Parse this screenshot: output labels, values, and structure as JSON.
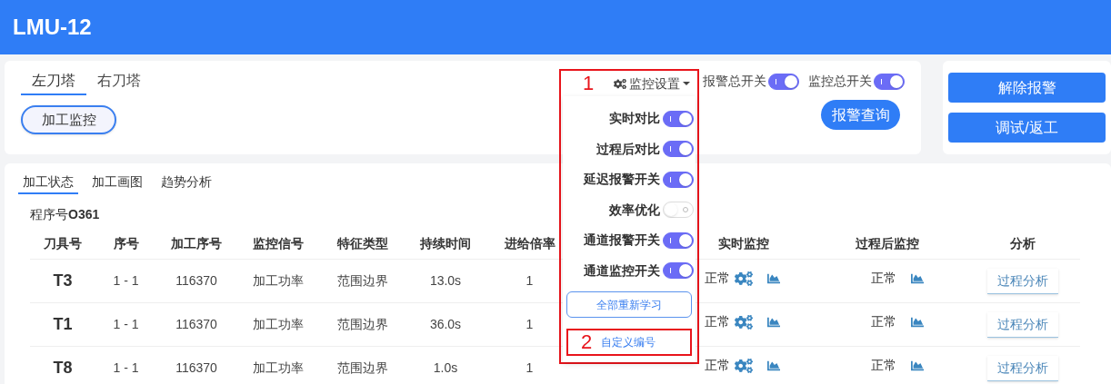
{
  "header": {
    "title": "LMU-12"
  },
  "turret_tabs": [
    {
      "label": "左刀塔",
      "selected": true
    },
    {
      "label": "右刀塔",
      "selected": false
    }
  ],
  "mode_button": "加工监控",
  "monitor_settings": {
    "label": "监控设置",
    "expanded": true,
    "items": [
      {
        "label": "实时对比",
        "on": true
      },
      {
        "label": "过程后对比",
        "on": true
      },
      {
        "label": "延迟报警开关",
        "on": true
      },
      {
        "label": "效率优化",
        "on": false
      },
      {
        "label": "通道报警开关",
        "on": true
      },
      {
        "label": "通道监控开关",
        "on": true
      }
    ],
    "buttons": [
      "全部重新学习",
      "自定义编号"
    ]
  },
  "master_switches": [
    {
      "label": "报警总开关",
      "on": true
    },
    {
      "label": "监控总开关",
      "on": true
    }
  ],
  "alarm_query_button": "报警查询",
  "side_buttons": [
    "解除报警",
    "调试/返工"
  ],
  "content_tabs": [
    {
      "label": "加工状态",
      "selected": true
    },
    {
      "label": "加工画图",
      "selected": false
    },
    {
      "label": "趋势分析",
      "selected": false
    }
  ],
  "program": "程序号**O361**",
  "table": {
    "columns": [
      "刀具号",
      "序号",
      "加工序号",
      "监控信号",
      "特征类型",
      "持续时间",
      "进给倍率",
      "实时监控",
      "过程后监控",
      "分析"
    ],
    "rows": [
      {
        "tool": "T3",
        "seq": "1 - 1",
        "proc_seq": "116370",
        "signal": "加工功率",
        "feature": "范围边界",
        "duration": "13.0s",
        "feed_rate": "1",
        "realtime_status": "正常",
        "post_status": "正常",
        "analysis": "过程分析"
      },
      {
        "tool": "T1",
        "seq": "1 - 1",
        "proc_seq": "116370",
        "signal": "加工功率",
        "feature": "范围边界",
        "duration": "36.0s",
        "feed_rate": "1",
        "realtime_status": "正常",
        "post_status": "正常",
        "analysis": "过程分析"
      },
      {
        "tool": "T8",
        "seq": "1 - 1",
        "proc_seq": "116370",
        "signal": "加工功率",
        "feature": "范围边界",
        "duration": "1.0s",
        "feed_rate": "1",
        "realtime_status": "正常",
        "post_status": "正常",
        "analysis": "过程分析"
      }
    ]
  },
  "annotations": [
    {
      "label": "1"
    },
    {
      "label": "2"
    }
  ]
}
